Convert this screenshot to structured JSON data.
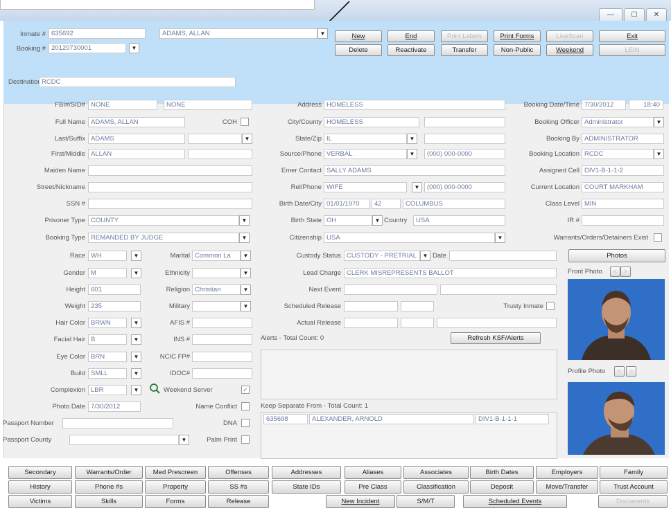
{
  "window": {
    "min": "—",
    "max": "☐",
    "close": "✕"
  },
  "header": {
    "inmate_label": "Inmate #",
    "inmate_no": "635692",
    "inmate_name": "ADAMS, ALLAN",
    "booking_label": "Booking #",
    "booking_no": "20120730001",
    "destination_label": "Destination",
    "destination": "RCDC"
  },
  "toolbar": {
    "new": "New",
    "end": "End",
    "print_labels": "Print Labels",
    "print_forms": "Print Forms",
    "live_scan": "LiveScan",
    "exit": "Exit",
    "delete": "Delete",
    "reactivate": "Reactivate",
    "transfer": "Transfer",
    "non_public": "Non-Public",
    "weekend": "Weekend",
    "lein": "LEIN"
  },
  "col1": {
    "fbi_label": "FBI#/SID#",
    "fbi": "NONE",
    "sid": "NONE",
    "fullname_label": "Full Name",
    "fullname": "ADAMS, ALLAN",
    "coh_label": "COH",
    "last_label": "Last/Suffix",
    "last": "ADAMS",
    "first_label": "First/Middle",
    "first": "ALLAN",
    "maiden_label": "Maiden Name",
    "street_label": "Street/Nickname",
    "ssn_label": "SSN #",
    "prisoner_type_label": "Prisoner Type",
    "prisoner_type": "COUNTY",
    "booking_type_label": "Booking Type",
    "booking_type": "REMANDED BY JUDGE"
  },
  "col2": {
    "address_label": "Address",
    "address": "HOMELESS",
    "city_label": "City/County",
    "city": "HOMELESS",
    "state_label": "State/Zip",
    "state": "IL",
    "source_label": "Source/Phone",
    "source": "VERBAL",
    "source_phone": "(000) 000-0000",
    "emer_label": "Emer Contact",
    "emer": "SALLY ADAMS",
    "rel_label": "Rel/Phone",
    "rel": "WIFE",
    "rel_phone": "(000) 000-0000",
    "birth_label": "Birth Date/City",
    "birth_date": "01/01/1970",
    "age": "42",
    "birth_city": "COLUMBUS",
    "birth_state_label": "Birth State",
    "birth_state": "OH",
    "country_label": "Country",
    "country": "USA",
    "citizen_label": "Citizenship",
    "citizen": "USA"
  },
  "col3": {
    "booking_dt_label": "Booking Date/Time",
    "booking_date": "7/30/2012",
    "booking_time": "18:40",
    "officer_label": "Booking Officer",
    "officer": "Administrator",
    "booking_by_label": "Booking By",
    "booking_by": "ADMINISTRATOR",
    "location_label": "Booking Location",
    "location": "RCDC",
    "cell_label": "Assigned Cell",
    "cell": "DIV1-B-1-1-2",
    "current_label": "Current Location",
    "current": "COURT MARKHAM",
    "class_label": "Class Level",
    "class": "MIN",
    "ir_label": "IR #",
    "warrants_label": "Warrants/Orders/Detainers Exist"
  },
  "phys": {
    "race_label": "Race",
    "race": "WH",
    "marital_label": "Marital",
    "marital": "Common La",
    "gender_label": "Gender",
    "gender": "M",
    "ethnicity_label": "Ethnicity",
    "height_label": "Height",
    "height": "601",
    "religion_label": "Religion",
    "religion": "Christian",
    "weight_label": "Weight",
    "weight": "235",
    "military_label": "Military",
    "hair_label": "Hair Color",
    "hair": "BRWN",
    "afis_label": "AFIS #",
    "facial_label": "Facial Hair",
    "facial": "B",
    "ins_label": "INS #",
    "eye_label": "Eye Color",
    "eye": "BRN",
    "ncic_label": "NCIC FP#",
    "build_label": "Build",
    "build": "SMLL",
    "idoc_label": "IDOC#",
    "complexion_label": "Complexion",
    "complexion": "LBR",
    "weekend_server_label": "Weekend Server",
    "photo_date_label": "Photo Date",
    "photo_date": "7/30/2012",
    "name_conflict_label": "Name Conflict",
    "passport_no_label": "Passport Number",
    "dna_label": "DNA",
    "passport_country_label": "Passport County",
    "palm_label": "Palm Print"
  },
  "custody": {
    "status_label": "Custody Status",
    "status": "CUSTODY - PRETRIAL",
    "date_label": "Date",
    "lead_label": "Lead Charge",
    "lead": "CLERK MISREPRESENTS BALLOT",
    "next_label": "Next Event",
    "sched_label": "Scheduled Release",
    "trusty_label": "Trusty Inmate",
    "actual_label": "Actual Release",
    "alerts_label": "Alerts - Total Count: 0",
    "refresh": "Refresh KSF/Alerts",
    "keep_label": "Keep Separate From - Total Count: 1",
    "keep_id": "635698",
    "keep_name": "ALEXANDER, ARNOLD",
    "keep_cell": "DIV1-B-1-1-1"
  },
  "photos": {
    "photos_btn": "Photos",
    "front_label": "Front Photo",
    "profile_label": "Profile Photo",
    "prev": "<",
    "next": ">"
  },
  "bottom": {
    "row1": [
      "Secondary",
      "Warrants/Order",
      "Med Prescreen",
      "Offenses",
      "Addresses",
      "Aliases",
      "Associates",
      "Birth Dates",
      "Employers",
      "Family"
    ],
    "row2": [
      "History",
      "Phone #s",
      "Property",
      "SS #s",
      "State IDs",
      "Pre Class",
      "Classification",
      "Deposit",
      "Move/Transfer",
      "Trust Account"
    ],
    "row3": [
      "Victims",
      "Skills",
      "Forms",
      "Release",
      "New Incident",
      "S/M/T",
      "Scheduled Events",
      "Documents"
    ]
  }
}
